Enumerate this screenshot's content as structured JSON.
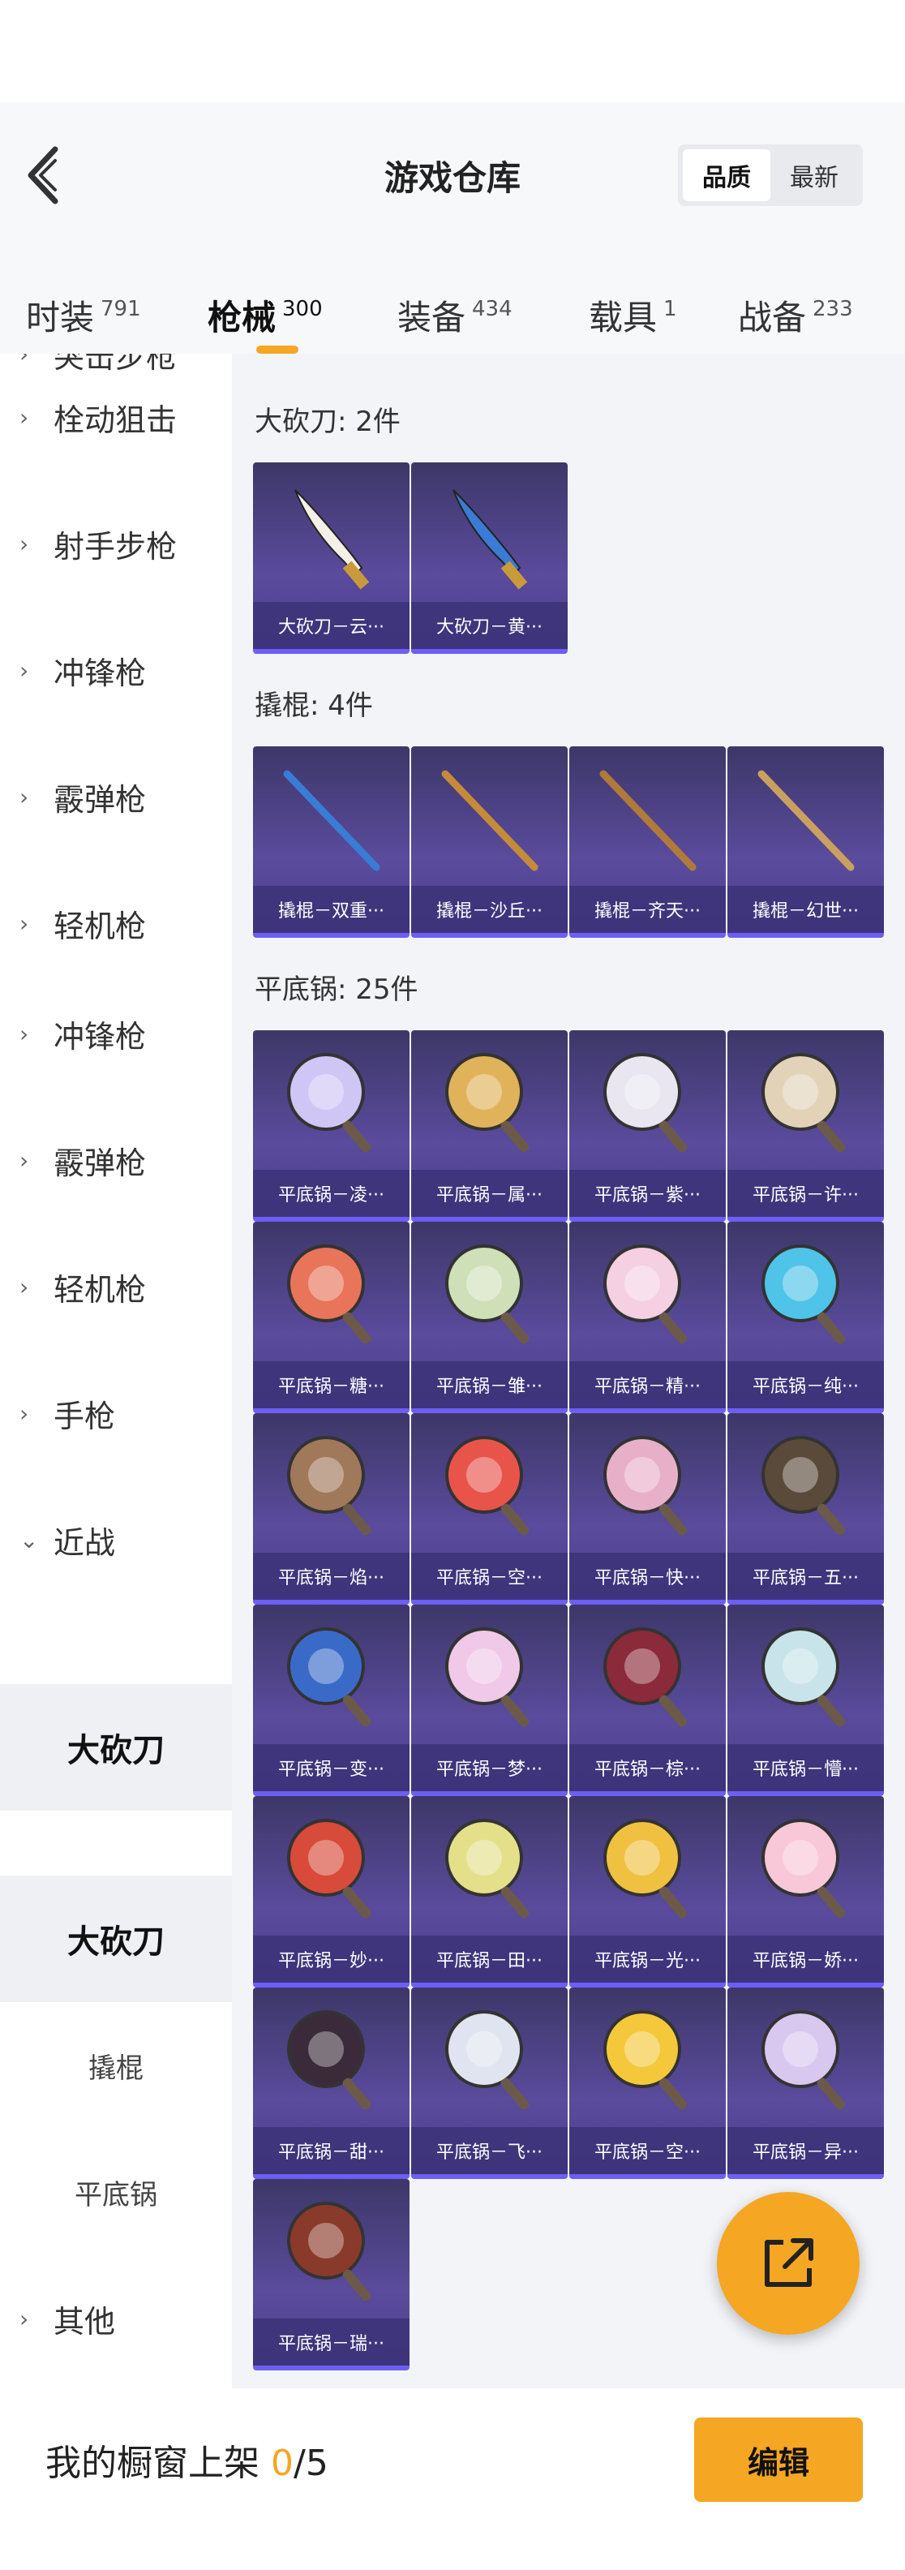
{
  "header": {
    "title": "游戏仓库",
    "sort_options": [
      "品质",
      "最新"
    ],
    "sort_selected": "品质"
  },
  "tabs": [
    {
      "label": "时装",
      "count": "791",
      "active": false
    },
    {
      "label": "枪械",
      "count": "300",
      "active": true
    },
    {
      "label": "装备",
      "count": "434",
      "active": false
    },
    {
      "label": "载具",
      "count": "1",
      "active": false
    },
    {
      "label": "战备",
      "count": "233",
      "active": false
    }
  ],
  "sidebar": {
    "items": [
      {
        "label": "突击步枪",
        "type": "cat",
        "state": "partial"
      },
      {
        "label": "栓动狙击",
        "type": "cat"
      },
      {
        "label": "射手步枪",
        "type": "cat"
      },
      {
        "label": "冲锋枪",
        "type": "cat"
      },
      {
        "label": "霰弹枪",
        "type": "cat"
      },
      {
        "label": "轻机枪",
        "type": "cat"
      },
      {
        "label": "冲锋枪",
        "type": "cat"
      },
      {
        "label": "霰弹枪",
        "type": "cat"
      },
      {
        "label": "轻机枪",
        "type": "cat"
      },
      {
        "label": "手枪",
        "type": "cat"
      },
      {
        "label": "近战",
        "type": "cat",
        "expanded": true
      },
      {
        "label": "大砍刀",
        "type": "selected"
      },
      {
        "label": "大砍刀",
        "type": "selected"
      },
      {
        "label": "撬棍",
        "type": "sub"
      },
      {
        "label": "平底锅",
        "type": "sub"
      },
      {
        "label": "其他",
        "type": "cat"
      }
    ]
  },
  "sections": [
    {
      "title": "大砍刀: 2件",
      "items": [
        "大砍刀－云···",
        "大砍刀－黄···"
      ]
    },
    {
      "title": "撬棍: 4件",
      "items": [
        "撬棍－双重···",
        "撬棍－沙丘···",
        "撬棍－齐天···",
        "撬棍－幻世···"
      ]
    },
    {
      "title": "平底锅: 25件",
      "items": [
        "平底锅－凌···",
        "平底锅－属···",
        "平底锅－紫···",
        "平底锅－许···",
        "平底锅－糖···",
        "平底锅－雏···",
        "平底锅－精···",
        "平底锅－纯···",
        "平底锅－焰···",
        "平底锅－空···",
        "平底锅－快···",
        "平底锅－五···",
        "平底锅－变···",
        "平底锅－梦···",
        "平底锅－棕···",
        "平底锅－懵···",
        "平底锅－妙···",
        "平底锅－田···",
        "平底锅－光···",
        "平底锅－娇···",
        "平底锅－甜···",
        "平底锅－飞···",
        "平底锅－空···",
        "平底锅－异···",
        "平底锅－瑞···"
      ]
    }
  ],
  "bottom": {
    "label": "我的橱窗上架",
    "current": "0",
    "total": "/5",
    "edit_label": "编辑"
  },
  "colors": {
    "accent": "#f5a623",
    "tile_bg": "#4d3f8e",
    "tile_border": "#6d5ef5"
  },
  "icons": {
    "back": "chevron-left-icon",
    "share": "share-external-icon",
    "expand": "chevron-right-icon",
    "collapse": "chevron-down-icon"
  }
}
